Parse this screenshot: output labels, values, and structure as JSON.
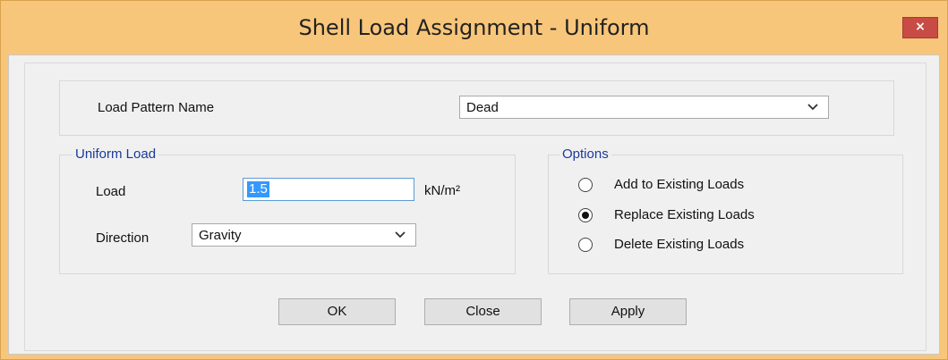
{
  "window": {
    "title": "Shell Load Assignment - Uniform",
    "close_glyph": "×"
  },
  "load_pattern": {
    "label": "Load Pattern Name",
    "value": "Dead"
  },
  "uniform_load": {
    "legend": "Uniform Load",
    "load_label": "Load",
    "load_value": "1.5",
    "load_unit": "kN/m²",
    "direction_label": "Direction",
    "direction_value": "Gravity"
  },
  "options": {
    "legend": "Options",
    "items": [
      {
        "label": "Add to Existing Loads",
        "selected": false
      },
      {
        "label": "Replace Existing Loads",
        "selected": true
      },
      {
        "label": "Delete Existing Loads",
        "selected": false
      }
    ]
  },
  "buttons": {
    "ok": "OK",
    "close": "Close",
    "apply": "Apply"
  }
}
